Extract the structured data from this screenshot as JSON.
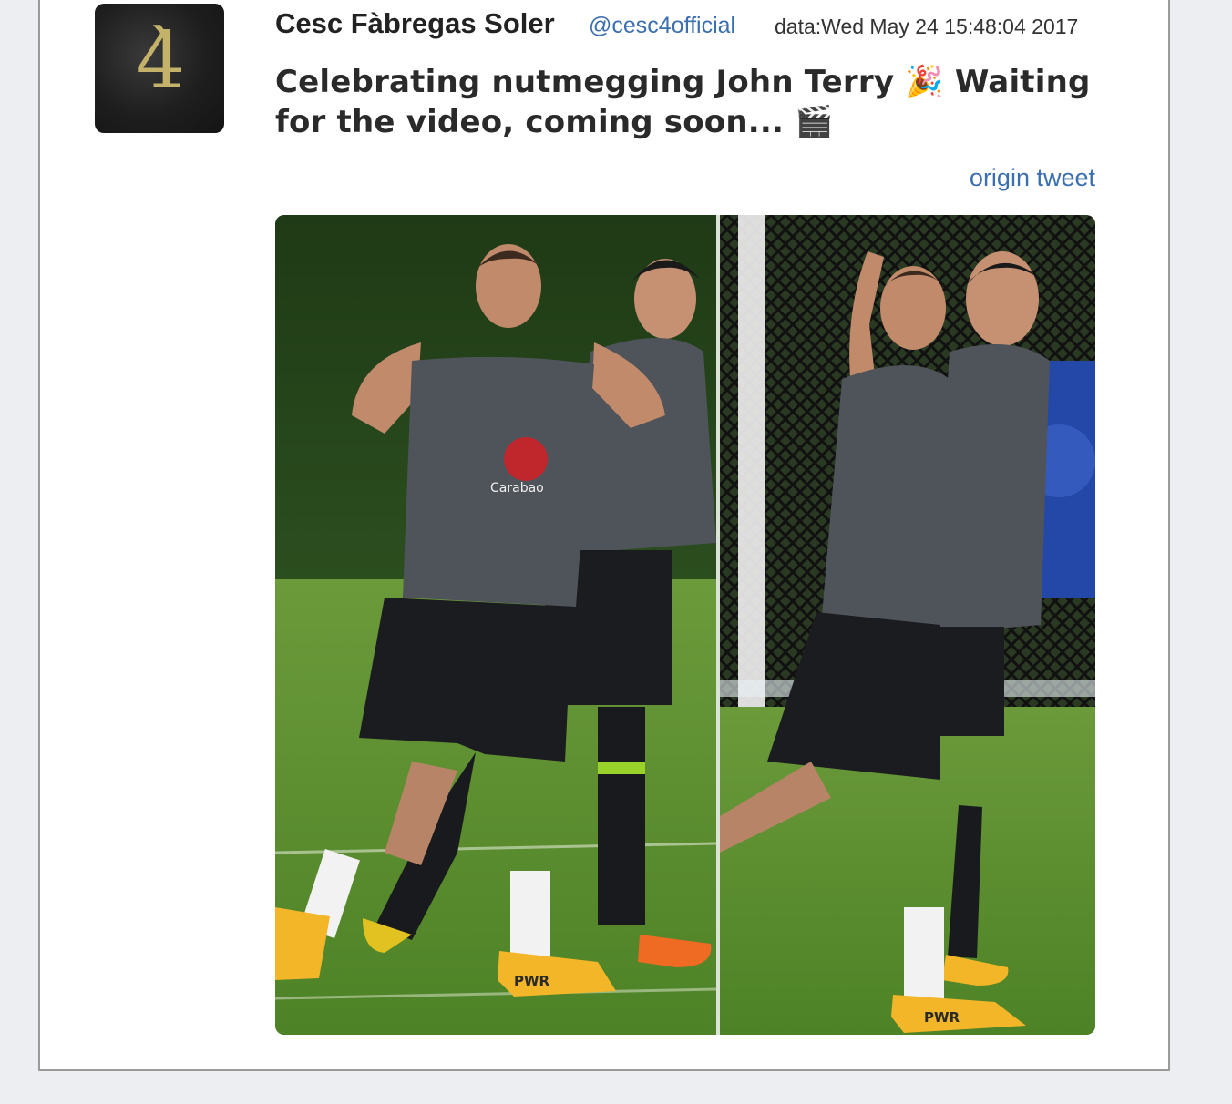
{
  "tweet": {
    "avatar_glyph": "4̀",
    "author_name": "Cesc Fàbregas Soler",
    "handle": "@cesc4official",
    "date": "data:Wed May 24 15:48:04 2017",
    "text": "Celebrating nutmegging John Terry 🎉 Waiting for the video, coming soon... 🎬",
    "origin_link": "origin tweet",
    "photo_caption_prints": {
      "sponsor_left": "Carabao",
      "boot_text_left": "PWR",
      "boot_text_right": "PWR"
    }
  },
  "colors": {
    "link": "#3b6fb0",
    "card_border": "#9a9a9a",
    "page_bg": "#eceef1",
    "shirt": "#4f535a",
    "shorts": "#1b1c20",
    "grass": "#5f8f33",
    "boot_yellow": "#f2b628"
  }
}
